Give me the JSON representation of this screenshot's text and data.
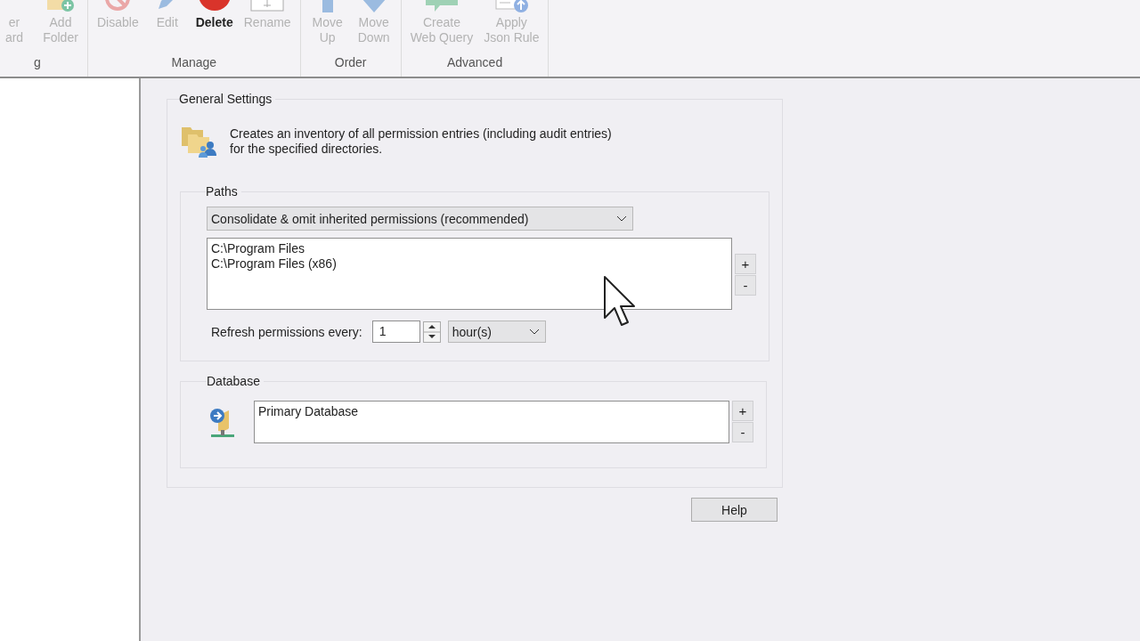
{
  "ribbon": {
    "groups": [
      {
        "label": "g",
        "buttons": [
          {
            "lines": [
              "er",
              "ard"
            ],
            "kind": "none",
            "enabled": false
          },
          {
            "lines": [
              "Add",
              "Folder"
            ],
            "kind": "folder",
            "enabled": false
          }
        ]
      },
      {
        "label": "Manage",
        "buttons": [
          {
            "lines": [
              "Disable"
            ],
            "kind": "ban",
            "enabled": false
          },
          {
            "lines": [
              "Edit"
            ],
            "kind": "pencil",
            "enabled": false
          },
          {
            "lines": [
              "Delete"
            ],
            "kind": "circle",
            "enabled": true
          },
          {
            "lines": [
              "Rename"
            ],
            "kind": "rename",
            "enabled": false
          }
        ]
      },
      {
        "label": "Order",
        "buttons": [
          {
            "lines": [
              "Move",
              "Up"
            ],
            "kind": "up",
            "enabled": false
          },
          {
            "lines": [
              "Move",
              "Down"
            ],
            "kind": "down",
            "enabled": false
          }
        ]
      },
      {
        "label": "Advanced",
        "buttons": [
          {
            "lines": [
              "Create",
              "Web Query"
            ],
            "kind": "chat",
            "enabled": false
          },
          {
            "lines": [
              "Apply",
              "Json Rule"
            ],
            "kind": "document",
            "enabled": false
          }
        ]
      }
    ]
  },
  "general_settings": {
    "title": "General Settings",
    "description": "Creates an inventory of all permission entries (including audit entries)\nfor the specified directories.",
    "paths": {
      "title": "Paths",
      "mode": "Consolidate & omit inherited permissions (recommended)",
      "items": [
        "C:\\Program Files",
        "C:\\Program Files (x86)"
      ],
      "add": "+",
      "remove": "-",
      "refresh_label": "Refresh permissions every:",
      "refresh_value": "1",
      "refresh_unit": "hour(s)"
    },
    "database": {
      "title": "Database",
      "items": [
        "Primary Database"
      ],
      "add": "+",
      "remove": "-"
    }
  },
  "help_button": "Help"
}
